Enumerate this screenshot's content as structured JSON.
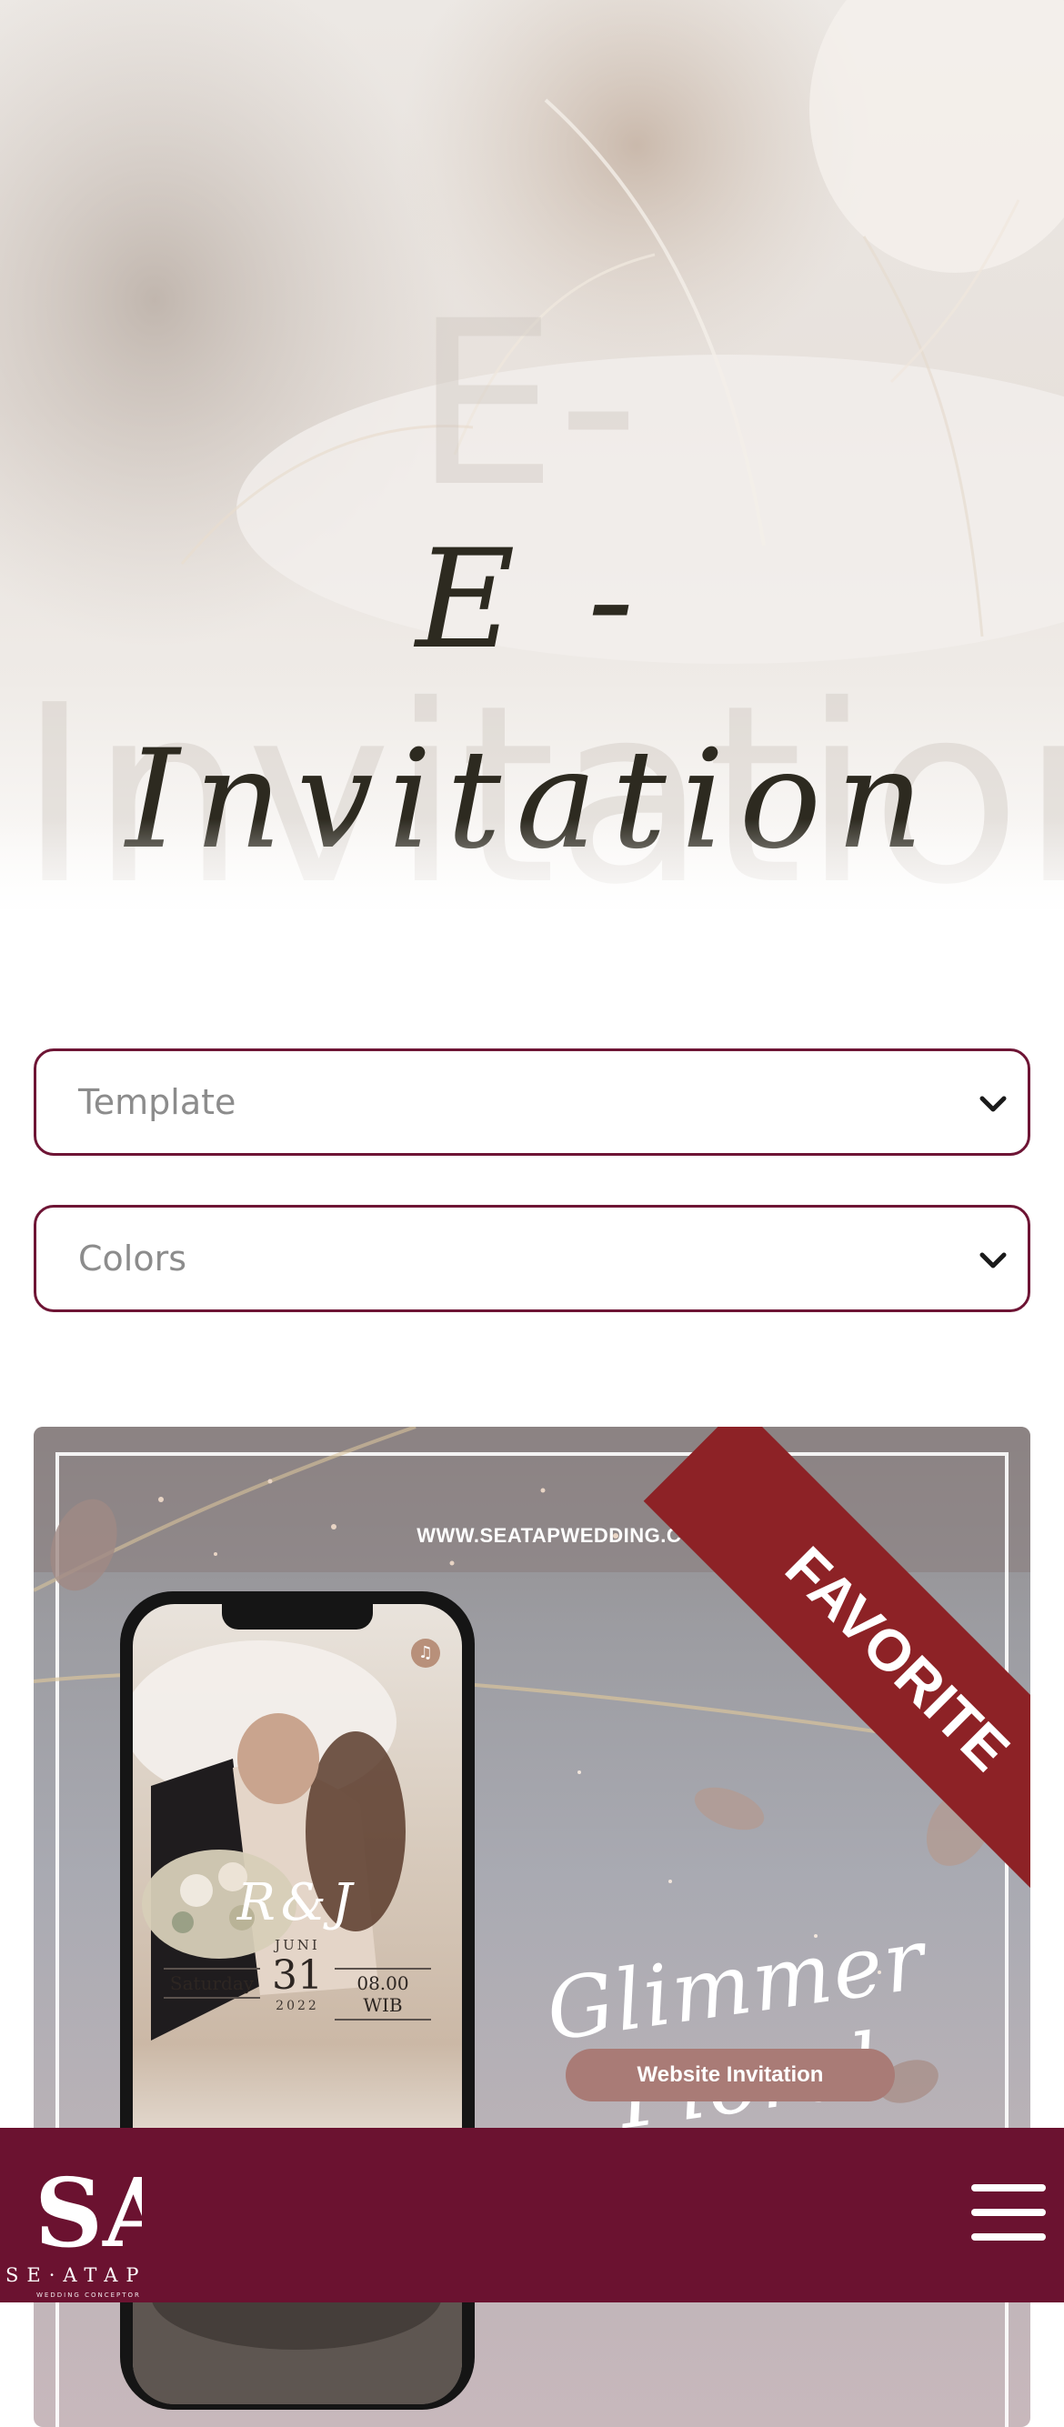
{
  "hero": {
    "ghost_line_1": "E-",
    "ghost_line_2": "Invitation",
    "title_line_1": "E -",
    "title_line_2": "Invitation"
  },
  "filters": {
    "template_label": "Template",
    "colors_label": "Colors"
  },
  "card": {
    "url": "WWW.SEATAPWEDDING.COM",
    "ribbon": "FAVORITE",
    "script_title": "Glimmer Floral",
    "pill_label": "Website Invitation",
    "phone": {
      "monogram": "R&J",
      "month": "JUNI",
      "day": "31",
      "year": "2022",
      "weekday": "Saturday",
      "time": "08.00 WIB"
    }
  },
  "footer": {
    "logo_mark": "SA",
    "logo_word": "SE·ATAP",
    "logo_sub": "WEDDING CONCEPTOR"
  },
  "colors": {
    "brand": "#6b1230",
    "ribbon": "#8d2226",
    "pill": "#a97b76"
  }
}
